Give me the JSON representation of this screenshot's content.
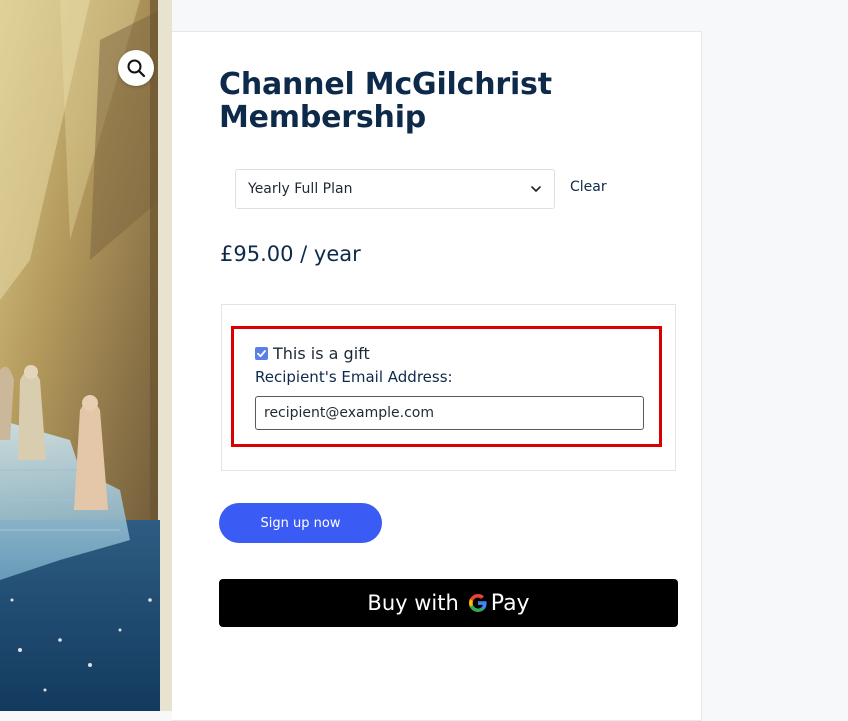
{
  "product": {
    "title": "Channel McGilchrist Membership",
    "price": "£95.00 / year"
  },
  "variation": {
    "selected": "Yearly Full Plan",
    "clear_label": "Clear"
  },
  "gift": {
    "checked": true,
    "checkbox_label": "This is a gift",
    "recipient_label": "Recipient's Email Address:",
    "recipient_value": "recipient@example.com"
  },
  "actions": {
    "signup_label": "Sign up now",
    "gpay_buy_label": "Buy with",
    "gpay_pay_label": "Pay"
  },
  "icons": {
    "zoom": "magnifier-icon",
    "select": "chevron-down-icon",
    "checkbox": "checkmark-icon",
    "gpay": "google-g-icon"
  },
  "colors": {
    "title": "#0e2a4a",
    "signup_button": "#3b5bf5",
    "highlight_border": "#d90000",
    "gpay_button": "#000000"
  }
}
